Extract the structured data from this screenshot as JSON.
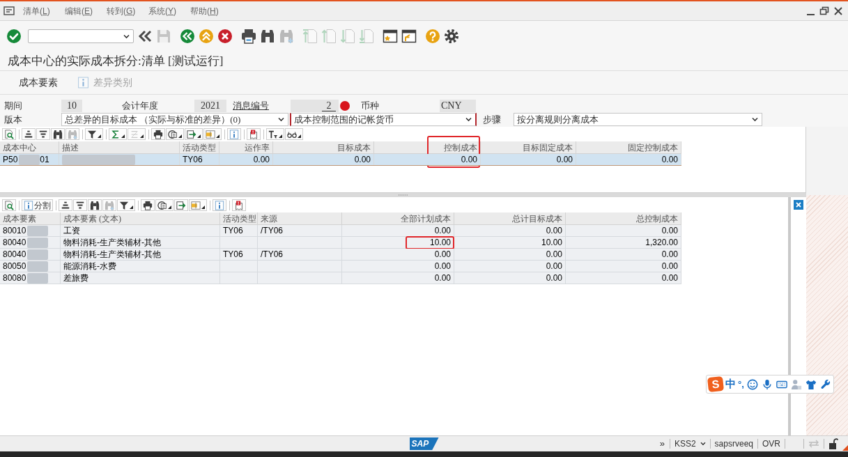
{
  "menu_bar": {
    "items": [
      "清单(L)",
      "编辑(E)",
      "转到(G)",
      "系统(Y)",
      "帮助(H)"
    ]
  },
  "toolbar": {
    "groups": [
      [
        {
          "kind": "enter",
          "disabled": false
        }
      ],
      [
        {
          "kind": "collapse",
          "disabled": false
        },
        {
          "kind": "save",
          "disabled": true
        }
      ],
      [
        {
          "kind": "back",
          "disabled": false
        },
        {
          "kind": "exit",
          "disabled": false
        },
        {
          "kind": "cancel",
          "disabled": false
        }
      ],
      [
        {
          "kind": "print",
          "disabled": false
        },
        {
          "kind": "find",
          "disabled": false
        },
        {
          "kind": "find_next",
          "disabled": true
        }
      ],
      [
        {
          "kind": "first_page",
          "disabled": true
        },
        {
          "kind": "previous_page",
          "disabled": true
        },
        {
          "kind": "next_page",
          "disabled": true
        },
        {
          "kind": "last_page",
          "disabled": true
        }
      ],
      [
        {
          "kind": "new_session",
          "disabled": false
        },
        {
          "kind": "shortcut",
          "disabled": false
        }
      ],
      [
        {
          "kind": "help",
          "disabled": false
        },
        {
          "kind": "settings",
          "disabled": false
        }
      ]
    ]
  },
  "title": "成本中心的实际成本拆分:清单 [测试运行]",
  "application_toolbar": {
    "buttons": [
      {
        "kind": "text",
        "label": "成本要素",
        "disabled": false
      },
      {
        "kind": "info",
        "label": "差异类别",
        "disabled": true
      }
    ]
  },
  "header": {
    "period": {
      "label": "期间",
      "value": "10"
    },
    "fiscal_year": {
      "label": "会计年度",
      "value": "2021"
    },
    "message_number": {
      "label": "消息编号",
      "value": "2",
      "error": true
    },
    "currency": {
      "label": "币种",
      "value": "CNY"
    },
    "version": {
      "label": "版本",
      "value": "总差异的目标成本 （实际与标准的差异）(0)",
      "focused": false
    },
    "currency_type": {
      "value": "成本控制范围的记帐货币",
      "focused": true
    },
    "step": {
      "label": "步骤",
      "value": "按分离规则分离成本",
      "focused": false
    }
  },
  "cost_center_grid": {
    "toolbar": [
      [
        {
          "kind": "details",
          "disabled": false,
          "menu": false
        }
      ],
      [
        {
          "kind": "sort_asc",
          "disabled": false,
          "menu": false
        },
        {
          "kind": "sort_desc",
          "disabled": false,
          "menu": false
        },
        {
          "kind": "find",
          "disabled": false,
          "menu": false
        },
        {
          "kind": "find_next",
          "disabled": true,
          "menu": false
        }
      ],
      [
        {
          "kind": "filter",
          "disabled": false,
          "menu": true
        }
      ],
      [
        {
          "kind": "sum",
          "disabled": false,
          "menu": true
        },
        {
          "kind": "subtotal",
          "disabled": true,
          "menu": true
        }
      ],
      [
        {
          "kind": "print",
          "disabled": false,
          "menu": false
        },
        {
          "kind": "views",
          "disabled": false,
          "menu": true
        },
        {
          "kind": "export",
          "disabled": false,
          "menu": true
        },
        {
          "kind": "layout",
          "disabled": false,
          "menu": true
        }
      ],
      [
        {
          "kind": "info",
          "disabled": false,
          "menu": false
        }
      ],
      [
        {
          "kind": "messages",
          "disabled": false,
          "menu": false
        }
      ],
      [
        {
          "kind": "text_format",
          "disabled": false,
          "menu": true
        },
        {
          "kind": "glasses",
          "disabled": false,
          "menu": true
        }
      ]
    ],
    "columns": [
      {
        "label": "成本中心",
        "highlighted": false
      },
      {
        "label": "描述",
        "highlighted": false
      },
      {
        "label": "活动类型",
        "highlighted": false
      },
      {
        "label": "运作率",
        "highlighted": false
      },
      {
        "label": "目标成本",
        "highlighted": false
      },
      {
        "label": "控制成本",
        "highlighted": true
      },
      {
        "label": "目标固定成本",
        "highlighted": false
      },
      {
        "label": "固定控制成本",
        "highlighted": false
      }
    ],
    "rows": [
      {
        "selected": true,
        "cells": [
          {
            "text": "P50",
            "text_after": "01",
            "redacted": true,
            "highlighted": false
          },
          {
            "redacted": true,
            "highlighted": false
          },
          {
            "text": "TY06",
            "redacted": false,
            "highlighted": false
          },
          {
            "text": "0.00",
            "redacted": false,
            "highlighted": false
          },
          {
            "text": "0.00",
            "redacted": false,
            "highlighted": false
          },
          {
            "text": "0.00",
            "redacted": false,
            "highlighted": false
          },
          {
            "text": "0.00",
            "redacted": false,
            "highlighted": false
          },
          {
            "text": "0.00",
            "redacted": false,
            "highlighted": false
          }
        ]
      }
    ]
  },
  "cost_element_grid": {
    "toolbar": [
      [
        {
          "kind": "details",
          "disabled": false,
          "menu": false
        }
      ],
      [
        {
          "kind": "info",
          "label": "分割",
          "disabled": false,
          "menu": false
        }
      ],
      [
        {
          "kind": "sort_asc",
          "disabled": false,
          "menu": false
        },
        {
          "kind": "sort_desc",
          "disabled": false,
          "menu": false
        },
        {
          "kind": "find",
          "disabled": false,
          "menu": false
        },
        {
          "kind": "find_next",
          "disabled": true,
          "menu": false
        },
        {
          "kind": "filter",
          "disabled": false,
          "menu": true
        }
      ],
      [
        {
          "kind": "print",
          "disabled": false,
          "menu": false
        },
        {
          "kind": "views",
          "disabled": false,
          "menu": true
        },
        {
          "kind": "export",
          "disabled": false,
          "menu": false
        },
        {
          "kind": "layout",
          "disabled": false,
          "menu": true
        }
      ],
      [
        {
          "kind": "info",
          "disabled": false,
          "menu": false
        }
      ],
      [
        {
          "kind": "messages",
          "disabled": false,
          "menu": false
        }
      ]
    ],
    "columns": [
      {
        "label": "成本要素",
        "highlighted": false
      },
      {
        "label": "成本要素 (文本)",
        "highlighted": false
      },
      {
        "label": "活动类型",
        "highlighted": false
      },
      {
        "label": "来源",
        "highlighted": false
      },
      {
        "label": "全部计划成本",
        "highlighted": false
      },
      {
        "label": "总计目标成本",
        "highlighted": false
      },
      {
        "label": "总控制成本",
        "highlighted": false
      }
    ],
    "rows": [
      {
        "selected": false,
        "cells": [
          {
            "text": "80010",
            "redacted": true,
            "highlighted": false
          },
          {
            "text": "工资",
            "redacted": false,
            "highlighted": false
          },
          {
            "text": "TY06",
            "redacted": false,
            "highlighted": false
          },
          {
            "text": "/TY06",
            "redacted": false,
            "highlighted": false
          },
          {
            "text": "0.00",
            "redacted": false,
            "highlighted": false
          },
          {
            "text": "0.00",
            "redacted": false,
            "highlighted": false
          },
          {
            "text": "0.00",
            "redacted": false,
            "highlighted": false
          }
        ]
      },
      {
        "selected": false,
        "cells": [
          {
            "text": "80040",
            "redacted": true,
            "highlighted": false
          },
          {
            "text": "物料消耗-生产类辅材-其他",
            "redacted": false,
            "highlighted": false
          },
          {
            "redacted": false,
            "highlighted": false
          },
          {
            "redacted": false,
            "highlighted": false
          },
          {
            "text": "10.00",
            "redacted": false,
            "highlighted": true
          },
          {
            "text": "10.00",
            "redacted": false,
            "highlighted": false
          },
          {
            "text": "1,320.00",
            "redacted": false,
            "highlighted": false
          }
        ]
      },
      {
        "selected": false,
        "cells": [
          {
            "text": "80040",
            "redacted": true,
            "highlighted": false
          },
          {
            "text": "物料消耗-生产类辅材-其他",
            "redacted": false,
            "highlighted": false
          },
          {
            "text": "TY06",
            "redacted": false,
            "highlighted": false
          },
          {
            "text": "/TY06",
            "redacted": false,
            "highlighted": false
          },
          {
            "text": "0.00",
            "redacted": false,
            "highlighted": false
          },
          {
            "text": "0.00",
            "redacted": false,
            "highlighted": false
          },
          {
            "text": "0.00",
            "redacted": false,
            "highlighted": false
          }
        ]
      },
      {
        "selected": false,
        "cells": [
          {
            "text": "80050",
            "redacted": true,
            "highlighted": false
          },
          {
            "text": "能源消耗-水费",
            "redacted": false,
            "highlighted": false
          },
          {
            "redacted": false,
            "highlighted": false
          },
          {
            "redacted": false,
            "highlighted": false
          },
          {
            "text": "0.00",
            "redacted": false,
            "highlighted": false
          },
          {
            "text": "0.00",
            "redacted": false,
            "highlighted": false
          },
          {
            "text": "0.00",
            "redacted": false,
            "highlighted": false
          }
        ]
      },
      {
        "selected": false,
        "cells": [
          {
            "text": "80080",
            "redacted": true,
            "highlighted": false
          },
          {
            "text": "差旅费",
            "redacted": false,
            "highlighted": false
          },
          {
            "redacted": false,
            "highlighted": false
          },
          {
            "redacted": false,
            "highlighted": false
          },
          {
            "text": "0.00",
            "redacted": false,
            "highlighted": false
          },
          {
            "text": "0.00",
            "redacted": false,
            "highlighted": false
          },
          {
            "text": "0.00",
            "redacted": false,
            "highlighted": false
          }
        ]
      }
    ]
  },
  "ime_toolbar": {
    "logo": "S",
    "mode": "中",
    "punctuation": "°,"
  },
  "status_bar": {
    "logo": "SAP",
    "overflow": "»",
    "system": "KSS2",
    "server": "sapsrveeq",
    "mode": "OVR"
  }
}
